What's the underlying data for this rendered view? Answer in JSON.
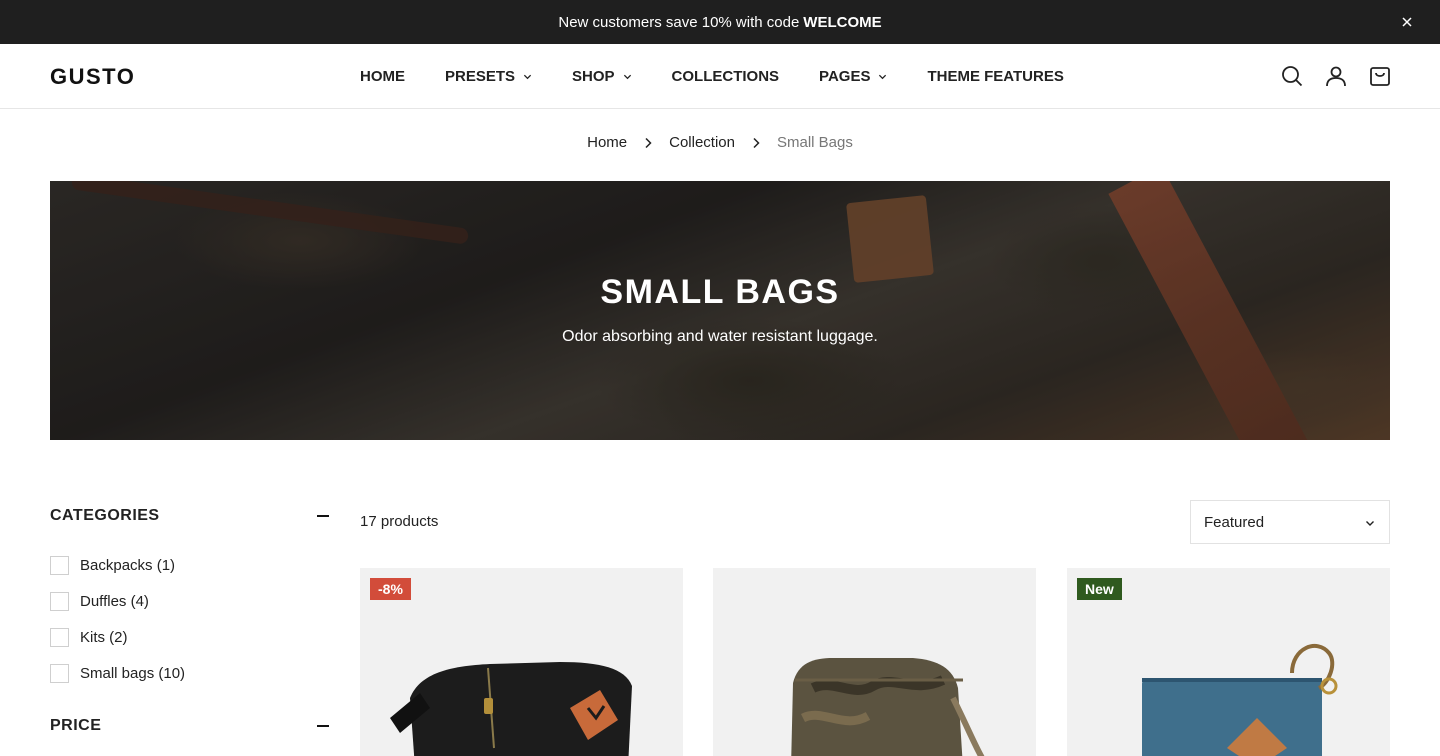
{
  "announcement": {
    "text": "New customers save 10% with code",
    "code": "WELCOME"
  },
  "header": {
    "logo": "GUSTO",
    "nav": [
      {
        "label": "HOME",
        "dropdown": false
      },
      {
        "label": "PRESETS",
        "dropdown": true
      },
      {
        "label": "SHOP",
        "dropdown": true
      },
      {
        "label": "COLLECTIONS",
        "dropdown": false
      },
      {
        "label": "PAGES",
        "dropdown": true
      },
      {
        "label": "THEME FEATURES",
        "dropdown": false
      }
    ],
    "icons": [
      "search-icon",
      "account-icon",
      "cart-icon"
    ]
  },
  "breadcrumb": [
    "Home",
    "Collection",
    "Small Bags"
  ],
  "hero": {
    "title": "SMALL BAGS",
    "subtitle": "Odor absorbing and water resistant luggage."
  },
  "filters": {
    "categories_title": "CATEGORIES",
    "categories": [
      "Backpacks (1)",
      "Duffles (4)",
      "Kits (2)",
      "Small bags (10)"
    ],
    "price_title": "PRICE"
  },
  "listing": {
    "count": "17 products",
    "sort": "Featured",
    "products": [
      {
        "badge": "-8%",
        "badge_type": "sale",
        "color": "#1c1c1c"
      },
      {
        "badge": "",
        "badge_type": "",
        "color": "#5b5340"
      },
      {
        "badge": "New",
        "badge_type": "new",
        "color": "#3f6f8c"
      }
    ]
  },
  "colors": {
    "announcement_bg": "#1f1f1f",
    "sale_badge": "#d24c3a",
    "new_badge": "#2f5a1f"
  }
}
